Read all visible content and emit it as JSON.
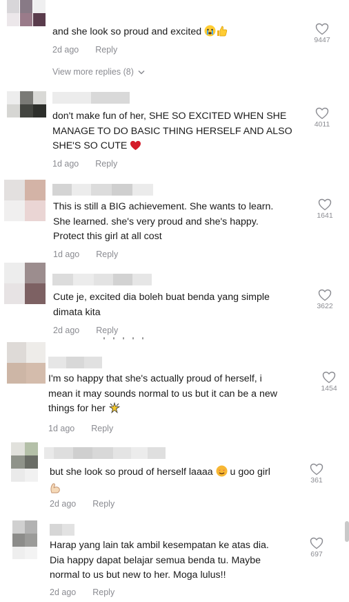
{
  "comments": [
    {
      "text_lines": [
        "and she look so proud and excited"
      ],
      "emoji": [
        "crying-face-emoji",
        "thumbs-up-emoji"
      ],
      "time": "2d ago",
      "reply_label": "Reply",
      "likes": "9447"
    },
    {
      "text_lines": [
        "don't make fun of her, SHE SO EXCITED WHEN SHE",
        "MANAGE TO DO BASIC THING HERSELF AND ALSO",
        "SHE'S SO CUTE"
      ],
      "emoji": [
        "red-heart-emoji"
      ],
      "time": "1d ago",
      "reply_label": "Reply",
      "likes": "4011"
    },
    {
      "text_lines": [
        "This is still a BIG achievement. She wants to learn.",
        "She learned. she's very proud and she's happy.",
        "Protect this girl at all cost"
      ],
      "time": "1d ago",
      "reply_label": "Reply",
      "likes": "1641"
    },
    {
      "text_lines": [
        "Cute je, excited dia boleh buat benda yang simple",
        "dimata kita"
      ],
      "time": "2d ago",
      "reply_label": "Reply",
      "likes": "3622"
    },
    {
      "text_lines": [
        "I'm so happy that she's actually proud of herself, i",
        "mean it may sounds normal to us but it can be a new",
        "things for her"
      ],
      "emoji": [
        "sparkle-dance-emoji"
      ],
      "time": "1d ago",
      "reply_label": "Reply",
      "likes": "1454"
    },
    {
      "text_lines": [
        "but she look so proud of herself laaaa",
        "u goo girl"
      ],
      "emoji": [
        "smiling-hearts-emoji",
        "flexed-biceps-emoji"
      ],
      "time": "2d ago",
      "reply_label": "Reply",
      "likes": "361"
    },
    {
      "text_lines": [
        "Harap yang lain tak ambil kesempatan ke atas dia.",
        "Dia happy dapat belajar semua benda tu. Maybe",
        "normal to us but new to her. Moga lulus!!"
      ],
      "time": "2d ago",
      "reply_label": "Reply",
      "likes": "697"
    }
  ],
  "view_more_replies": "View more replies (8)",
  "colors": {
    "text": "#1a1a1a",
    "meta": "#8a8b91",
    "heart": "#e0245e"
  }
}
